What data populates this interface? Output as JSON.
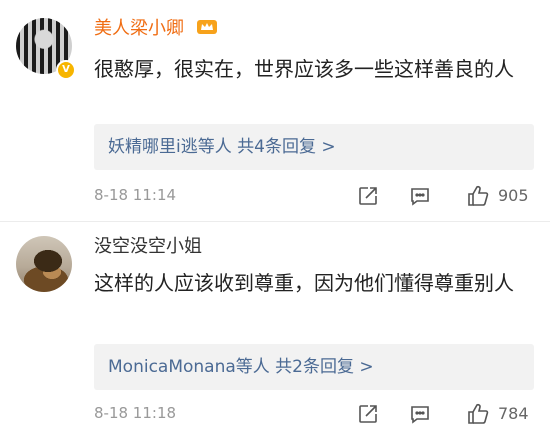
{
  "comments": [
    {
      "username": "美人梁小卿",
      "text": "很憨厚，很实在，世界应该多一些这样善良的人",
      "replies_summary": "妖精哪里i逃等人 共4条回复 >",
      "timestamp": "8-18 11:14",
      "like_count": "905",
      "verified": true,
      "username_color": "#f06d13"
    },
    {
      "username": "没空没空小姐",
      "text": "这样的人应该收到尊重，因为他们懂得尊重别人",
      "replies_summary": "MonicaMonana等人 共2条回复 >",
      "timestamp": "8-18 11:18",
      "like_count": "784",
      "verified": false,
      "username_color": "#333333"
    }
  ],
  "icons": {
    "vip": "crown-icon",
    "share": "share-icon",
    "comment": "comment-icon",
    "like": "thumbs-up-icon"
  },
  "colors": {
    "link": "#4b6a94",
    "reply_bg": "#f2f2f2",
    "meta": "#999999"
  }
}
